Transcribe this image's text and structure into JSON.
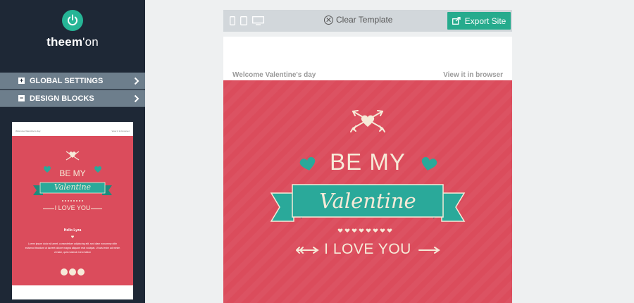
{
  "app": {
    "brand_main": "theem",
    "brand_suffix": "'on"
  },
  "sidebar": {
    "menu": [
      {
        "label": "GLOBAL SETTINGS",
        "icon": "plus-box-icon",
        "expanded": false
      },
      {
        "label": "DESIGN BLOCKS",
        "icon": "minus-box-icon",
        "expanded": true
      }
    ]
  },
  "toolbar": {
    "devices": [
      "phone-icon",
      "tablet-icon",
      "desktop-icon"
    ],
    "clear_label": "Clear Template",
    "export_label": "Export Site"
  },
  "email": {
    "pre_header_left": "Welcome Valentine's day",
    "pre_header_right": "View it in browser",
    "hero_line1": "BE MY",
    "hero_ribbon": "Valentine",
    "hero_line3": "I LOVE YOU",
    "dots_count": 8
  },
  "thumbnail": {
    "pre_header_left": "Welcome Valentine's day",
    "pre_header_right": "View it in browser",
    "line1": "BE MY",
    "ribbon": "Valentine",
    "line3": "I LOVE YOU",
    "greeting": "Hello Lyza",
    "body": "Lorem ipsum dolor sit amet, consectetuer adipiscing elit, sed diam nonummy nibh euismod tincidunt ut laoreet dolore magna aliquam erat volutpat. Ut wisi enim ad minim veniam, quis nostrud exerci tation"
  },
  "colors": {
    "sidebar_bg": "#1e2836",
    "accent": "#26ab8d",
    "hero_red": "#db4c5c",
    "ribbon_teal": "#2aa99a",
    "cream": "#f6ead8"
  }
}
